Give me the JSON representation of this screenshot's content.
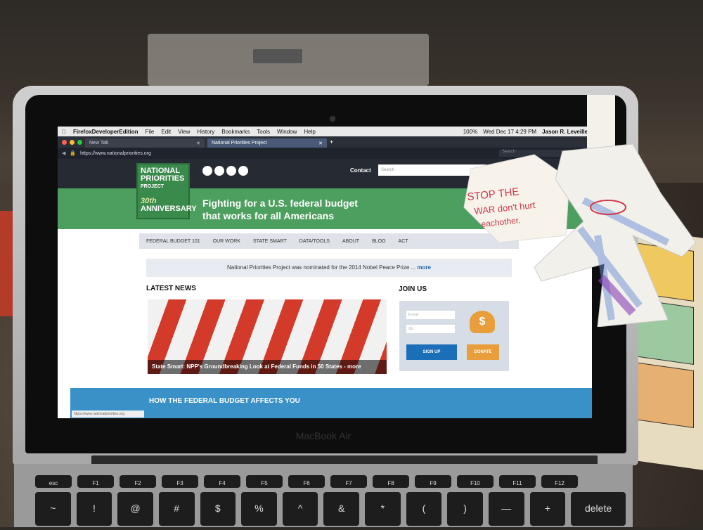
{
  "menubar": {
    "app": "FirefoxDeveloperEdition",
    "items": [
      "File",
      "Edit",
      "View",
      "History",
      "Bookmarks",
      "Tools",
      "Window",
      "Help"
    ],
    "battery": "100%",
    "datetime": "Wed Dec 17  4:29 PM",
    "user": "Jason R. Leveille"
  },
  "tabs": [
    {
      "label": "New Tab",
      "active": false
    },
    {
      "label": "National Priorities Project",
      "active": true
    }
  ],
  "address": {
    "url": "https://www.nationalpriorities.org",
    "search_placeholder": "Search"
  },
  "site": {
    "logo_line1": "NATIONAL",
    "logo_line2": "PRIORITIES",
    "logo_line3": "PROJECT",
    "logo_years": "30th",
    "logo_anniv": "ANNIVERSARY",
    "contact": "Contact",
    "search_placeholder": "Search",
    "hero_line1": "Fighting for a U.S. federal budget",
    "hero_line2": "that works for all Americans",
    "nav": [
      "FEDERAL BUDGET 101",
      "OUR WORK",
      "STATE SMART",
      "DATA/TOOLS",
      "ABOUT",
      "BLOG",
      "ACT"
    ],
    "notice_text": "National Priorities Project was nominated for the 2014 Nobel Peace Prize ...",
    "notice_link": "more",
    "latest_heading": "LATEST NEWS",
    "news_caption": "State Smart: NPP's Groundbreaking Look at Federal Funds in 50 States - more",
    "join_heading": "JOIN US",
    "email_placeholder": "E-mail",
    "zip_placeholder": "Zip",
    "signup_label": "SIGN UP",
    "donate_label": "DONATE",
    "donate_symbol": "$",
    "band_title": "HOW THE FEDERAL BUDGET AFFECTS YOU",
    "status_url": "https://www.nationalpriorities.org"
  },
  "laptop": {
    "brand": "MacBook Air"
  },
  "keyboard": {
    "fn": [
      "esc",
      "F1",
      "F2",
      "F3",
      "F4",
      "F5",
      "F6",
      "F7",
      "F8",
      "F9",
      "F10",
      "F11",
      "F12"
    ],
    "num": [
      "~",
      "!",
      "@",
      "#",
      "$",
      "%",
      "^",
      "&",
      "*",
      "(",
      ")",
      "—",
      "+",
      "delete"
    ]
  },
  "note": {
    "line1": "STOP THE",
    "line2": "WAR don't hurt",
    "line3": "eachother."
  },
  "colors": {
    "hero": "#4d9f5f",
    "band": "#3a91c7",
    "signup": "#1b6fb8",
    "donate": "#e89e3a",
    "note_ink": "#d0364a"
  }
}
